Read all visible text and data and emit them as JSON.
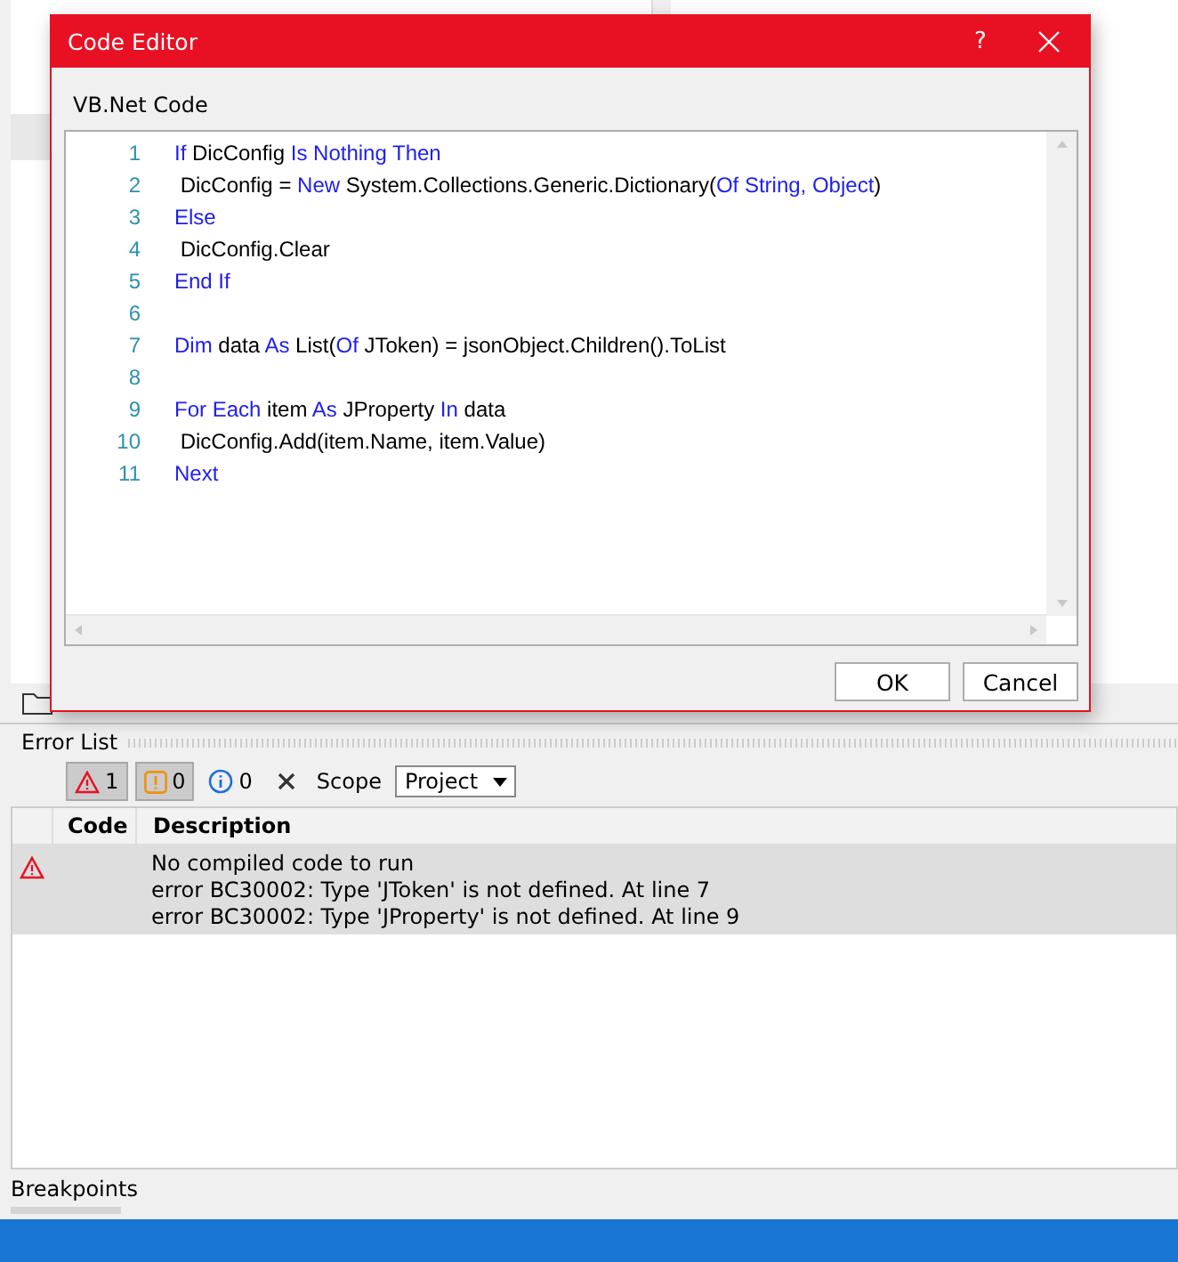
{
  "dialog": {
    "title": "Code Editor",
    "help_button": "?",
    "section_label": "VB.Net Code",
    "code_lines": [
      {
        "number": "1",
        "segments": [
          {
            "text": "If",
            "kind": "keyword"
          },
          {
            "text": " DicConfig ",
            "kind": "plain"
          },
          {
            "text": "Is Nothing Then",
            "kind": "keyword"
          }
        ]
      },
      {
        "number": "2",
        "segments": [
          {
            "text": " DicConfig = ",
            "kind": "plain"
          },
          {
            "text": "New",
            "kind": "keyword"
          },
          {
            "text": " System.Collections.Generic.Dictionary(",
            "kind": "plain"
          },
          {
            "text": "Of String, Object",
            "kind": "keyword"
          },
          {
            "text": ")",
            "kind": "plain"
          }
        ]
      },
      {
        "number": "3",
        "segments": [
          {
            "text": "Else",
            "kind": "keyword"
          }
        ]
      },
      {
        "number": "4",
        "segments": [
          {
            "text": " DicConfig.Clear",
            "kind": "plain"
          }
        ]
      },
      {
        "number": "5",
        "segments": [
          {
            "text": "End If",
            "kind": "keyword"
          }
        ]
      },
      {
        "number": "6"
      },
      {
        "number": "7",
        "segments": [
          {
            "text": "Dim",
            "kind": "keyword"
          },
          {
            "text": " data ",
            "kind": "plain"
          },
          {
            "text": "As",
            "kind": "keyword"
          },
          {
            "text": " List(",
            "kind": "plain"
          },
          {
            "text": "Of",
            "kind": "keyword"
          },
          {
            "text": " JToken) = jsonObject.Children().ToList",
            "kind": "plain"
          }
        ]
      },
      {
        "number": "8"
      },
      {
        "number": "9",
        "segments": [
          {
            "text": "For Each",
            "kind": "keyword"
          },
          {
            "text": " item ",
            "kind": "plain"
          },
          {
            "text": "As",
            "kind": "keyword"
          },
          {
            "text": " JProperty ",
            "kind": "plain"
          },
          {
            "text": "In",
            "kind": "keyword"
          },
          {
            "text": " data",
            "kind": "plain"
          }
        ]
      },
      {
        "number": "10",
        "segments": [
          {
            "text": " DicConfig.Add(item.Name, item.Value)",
            "kind": "plain"
          }
        ]
      },
      {
        "number": "11",
        "segments": [
          {
            "text": "Next",
            "kind": "keyword"
          }
        ]
      }
    ],
    "buttons": [
      "OK",
      "Cancel"
    ]
  },
  "error_list": {
    "title": "Error List",
    "filters": [
      {
        "kind": "error",
        "count": "1",
        "selected": true
      },
      {
        "kind": "warning",
        "count": "0",
        "selected": true
      },
      {
        "kind": "info",
        "count": "0",
        "selected": false
      }
    ],
    "scope_label": "Scope",
    "scope_value": "Project",
    "columns": [
      "Code",
      "Description"
    ],
    "rows": [
      {
        "kind": "error",
        "description": "No compiled code to run\nerror BC30002: Type 'JToken' is not defined. At line 7\nerror BC30002: Type 'JProperty' is not defined. At line 9",
        "selected": true
      }
    ]
  },
  "bottom_panel": {
    "title": "Breakpoints"
  }
}
